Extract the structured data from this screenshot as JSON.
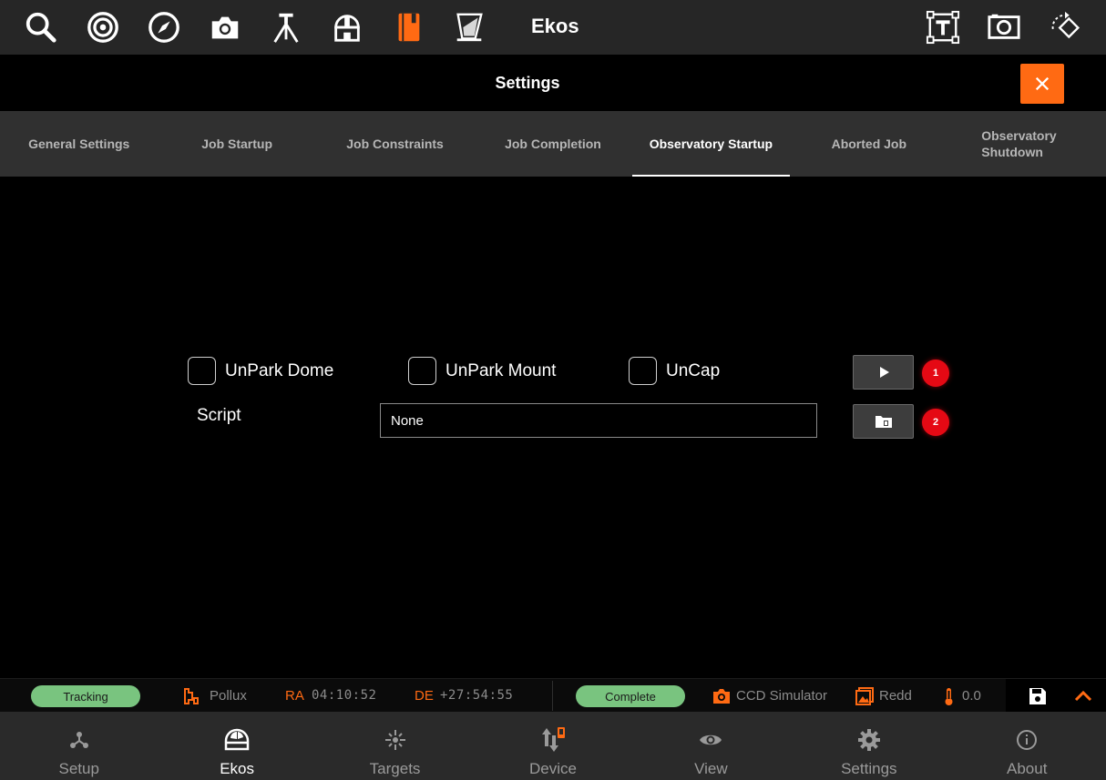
{
  "toolbar": {
    "icons": [
      "search-icon",
      "target-icon",
      "compass-icon",
      "camera-icon",
      "tripod-icon",
      "observatory-icon",
      "notebook-icon",
      "flat-panel-icon",
      "text-frame-icon",
      "screenshot-icon",
      "rotate-icon"
    ],
    "title": "Ekos"
  },
  "settings": {
    "title": "Settings"
  },
  "tabs": [
    {
      "label": "General Settings"
    },
    {
      "label": "Job Startup"
    },
    {
      "label": "Job Constraints"
    },
    {
      "label": "Job Completion"
    },
    {
      "label": "Observatory Startup"
    },
    {
      "label": "Aborted Job"
    },
    {
      "label": "Observatory Shutdown"
    }
  ],
  "active_tab": "Observatory Startup",
  "startup": {
    "unpark_dome": "UnPark Dome",
    "unpark_mount": "UnPark Mount",
    "uncap": "UnCap",
    "script_label": "Script",
    "script_value": "None",
    "badge_run": "1",
    "badge_browse": "2"
  },
  "status": {
    "mount_state": "Tracking",
    "target": "Pollux",
    "ra_label": "RA",
    "ra_value": "04:10:52",
    "de_label": "DE",
    "de_value": "+27:54:55",
    "capture_state": "Complete",
    "camera": "CCD Simulator",
    "filter": "Redd",
    "temperature": "0.0"
  },
  "colors": {
    "accent": "#ff6a13",
    "badge": "#e50914",
    "status_ok": "#79c47f",
    "toolbar_bg": "#262626",
    "tab_bg": "#303030",
    "nav_bg": "#2a2a2a"
  },
  "nav": [
    {
      "label": "Setup",
      "icon": "setup-icon"
    },
    {
      "label": "Ekos",
      "icon": "ekos-icon"
    },
    {
      "label": "Targets",
      "icon": "targets-icon"
    },
    {
      "label": "Device",
      "icon": "device-icon"
    },
    {
      "label": "View",
      "icon": "eye-icon"
    },
    {
      "label": "Settings",
      "icon": "gear-icon"
    },
    {
      "label": "About",
      "icon": "info-icon"
    }
  ],
  "active_nav": "Ekos"
}
